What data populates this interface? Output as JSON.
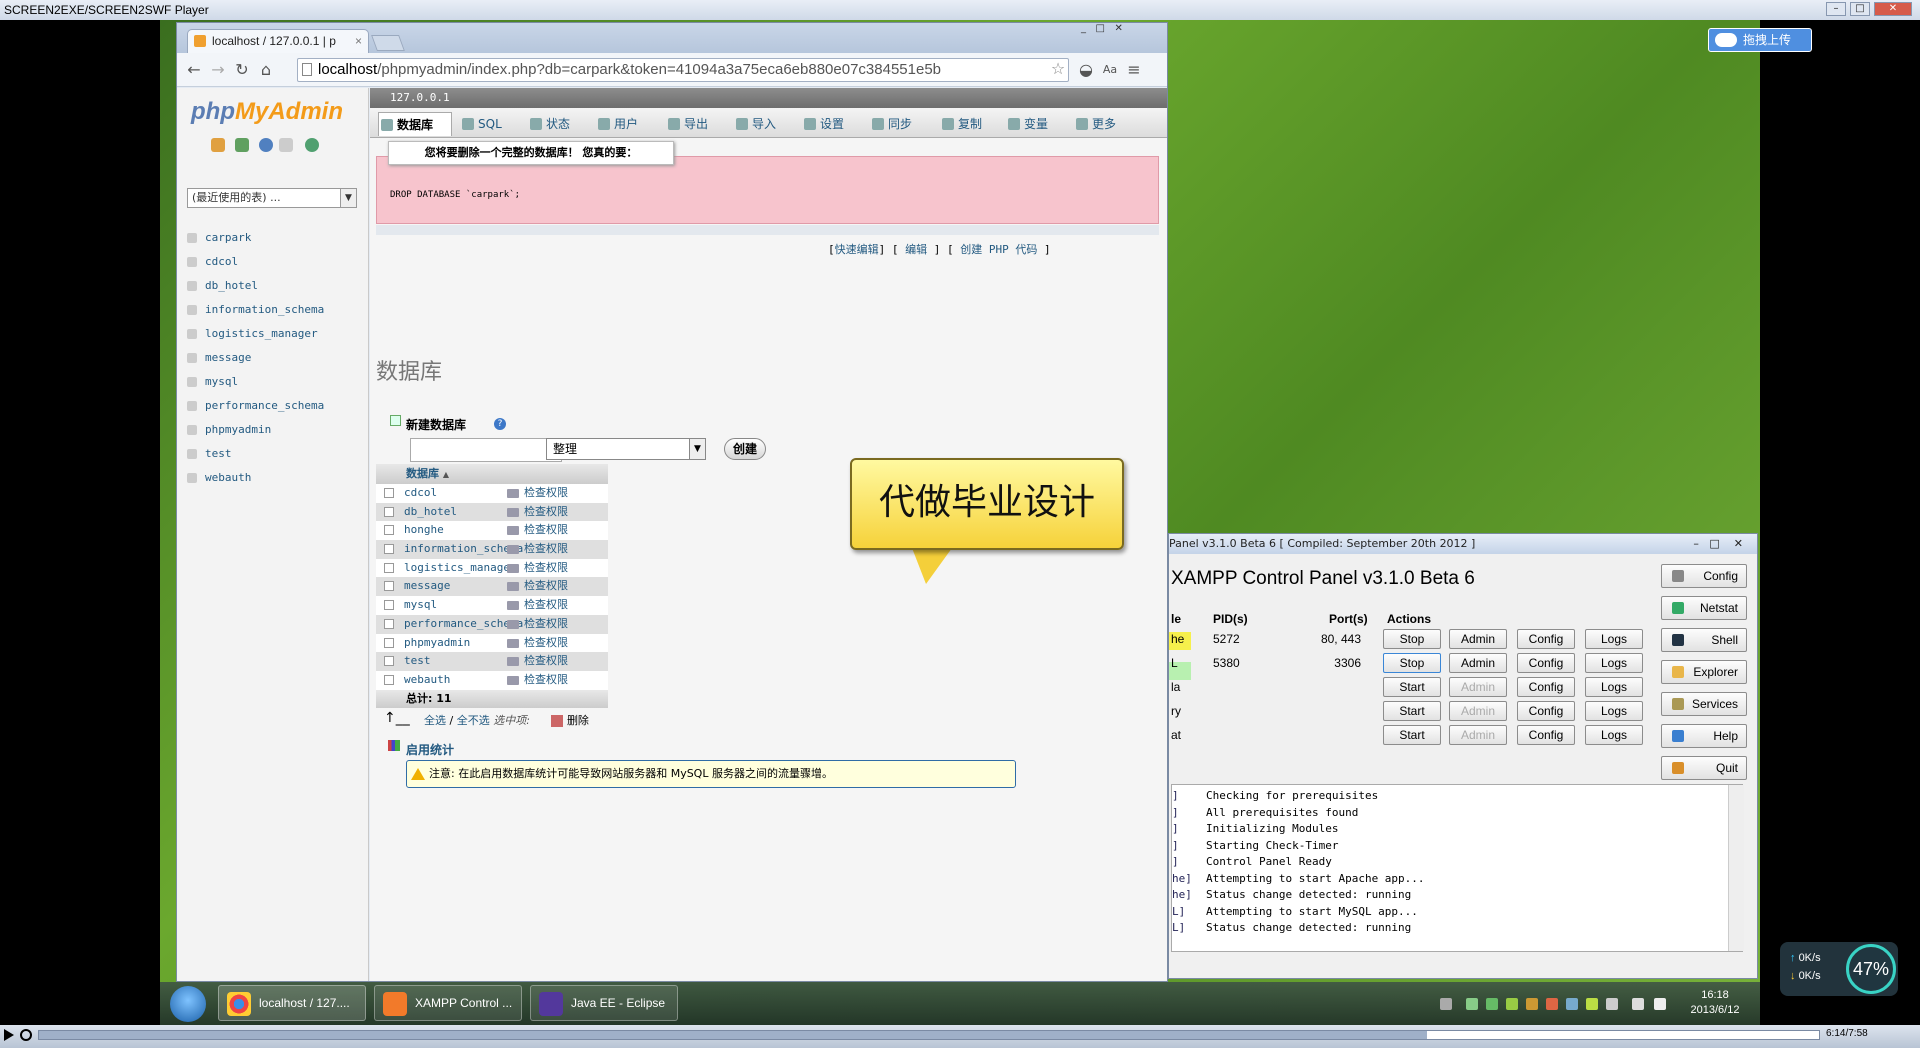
{
  "player": {
    "title": "SCREEN2EXE/SCREEN2SWF Player",
    "time": "6:14/7:58",
    "progress": 0.78
  },
  "overlay": {
    "upload_label": "拖拽上传",
    "net_up": "0K/s",
    "net_down": "0K/s",
    "gauge": "47%"
  },
  "browser": {
    "tab_title": "localhost / 127.0.0.1 | p",
    "url_host": "localhost",
    "url_rest": "/phpmyadmin/index.php?db=carpark&token=41094a3a75eca6eb880e07c384551e5b"
  },
  "pma": {
    "logo_php": "php",
    "logo_my": "MyAdmin",
    "recent": "(最近使用的表) ...",
    "sidebar_dbs": [
      "carpark",
      "cdcol",
      "db_hotel",
      "information_schema",
      "logistics_manager",
      "message",
      "mysql",
      "performance_schema",
      "phpmyadmin",
      "test",
      "webauth"
    ],
    "server": "127.0.0.1",
    "tabs": [
      "数据库",
      "SQL",
      "状态",
      "用户",
      "导出",
      "导入",
      "设置",
      "同步",
      "复制",
      "变量",
      "更多"
    ],
    "confirm_msg": "您将要删除一个完整的数据库！ 您真的要：",
    "sql": "DROP DATABASE `carpark`;",
    "links": {
      "quick_edit": "快速编辑",
      "edit": "编辑",
      "create_php": "创建 PHP 代码"
    },
    "heading": "数据库",
    "new_db_label": "新建数据库",
    "collation": "整理",
    "create_btn": "创建",
    "table_header": "数据库",
    "check_priv": "检查权限",
    "dbs": [
      "cdcol",
      "db_hotel",
      "honghe",
      "information_schema",
      "logistics_manager",
      "message",
      "mysql",
      "performance_schema",
      "phpmyadmin",
      "test",
      "webauth"
    ],
    "total": "总计: 11",
    "select_all": "全选",
    "sep": "/",
    "deselect_all": "全不选",
    "with_selected": "选中项:",
    "delete": "删除",
    "enable_stats": "启用统计",
    "notice": "注意: 在此启用数据库统计可能导致网站服务器和 MySQL 服务器之间的流量骤增。"
  },
  "callout": "代做毕业设计",
  "xampp": {
    "title": "Panel v3.1.0 Beta 6  [ Compiled: September 20th 2012 ]",
    "heading": "XAMPP Control Panel v3.1.0 Beta 6",
    "col_module": "le",
    "col_pid": "PID(s)",
    "col_port": "Port(s)",
    "col_actions": "Actions",
    "rows": [
      {
        "mod": "he",
        "pid": "5272",
        "port": "80, 443",
        "b1": "Stop",
        "b2": "Admin"
      },
      {
        "mod": "L",
        "pid": "5380",
        "port": "3306",
        "b1": "Stop",
        "b2": "Admin"
      },
      {
        "mod": "la",
        "pid": "",
        "port": "",
        "b1": "Start",
        "b2": "Admin"
      },
      {
        "mod": "ry",
        "pid": "",
        "port": "",
        "b1": "Start",
        "b2": "Admin"
      },
      {
        "mod": "at",
        "pid": "",
        "port": "",
        "b1": "Start",
        "b2": "Admin"
      }
    ],
    "config": "Config",
    "logs": "Logs",
    "side": [
      "Config",
      "Netstat",
      "Shell",
      "Explorer",
      "Services",
      "Help",
      "Quit"
    ],
    "log": [
      {
        "m": "]",
        "t": "Checking for prerequisites"
      },
      {
        "m": "]",
        "t": "All prerequisites found"
      },
      {
        "m": "]",
        "t": "Initializing Modules"
      },
      {
        "m": "]",
        "t": "Starting Check-Timer"
      },
      {
        "m": "]",
        "t": "Control Panel Ready"
      },
      {
        "m": "he]",
        "t": "Attempting to start Apache app..."
      },
      {
        "m": "he]",
        "t": "Status change detected: running"
      },
      {
        "m": "L]",
        "t": "Attempting to start MySQL app..."
      },
      {
        "m": "L]",
        "t": "Status change detected: running"
      }
    ]
  },
  "taskbar": {
    "items": [
      "localhost / 127....",
      "XAMPP Control ...",
      "Java EE - Eclipse"
    ],
    "time": "16:18",
    "date": "2013/6/12"
  }
}
